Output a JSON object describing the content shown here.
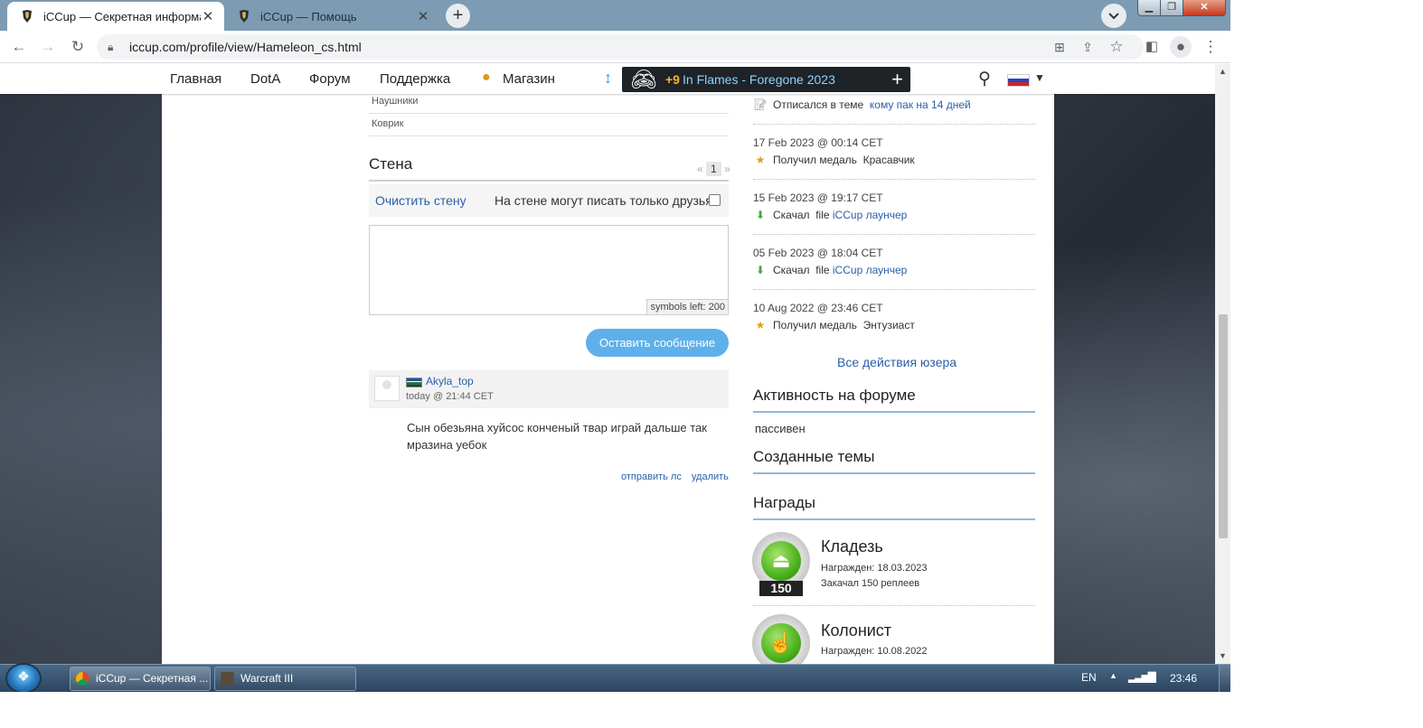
{
  "browser": {
    "tabs": [
      {
        "title": "iCCup — Секретная информаци",
        "active": true
      },
      {
        "title": "iCCup — Помощь",
        "active": false
      }
    ],
    "new_tab": "+",
    "url": "iccup.com/profile/view/Hameleon_cs.html",
    "window_controls": {
      "minimize": "▁",
      "maximize": "❐",
      "close": "✕"
    }
  },
  "site_nav": {
    "items": [
      "Главная",
      "DotA",
      "Форум",
      "Поддержка",
      "Магазин"
    ],
    "promo": {
      "count": "+9",
      "title": "In Flames - Foregone 2023"
    }
  },
  "profile_specs": [
    {
      "label": "Наушники"
    },
    {
      "label": "Коврик"
    }
  ],
  "wall": {
    "title": "Стена",
    "pager": {
      "prev": "«",
      "current": "1",
      "next": "»"
    },
    "clear_label": "Очистить стену",
    "friends_only_label": "На стене могут писать только друзья",
    "symbols_left": "symbols left: 200",
    "post_button": "Оставить сообщение",
    "messages": [
      {
        "author": "Akyla_top",
        "time": "today @ 21:44 CET",
        "text": "Сын обезьяна хуйсос конченый твар играй дальше так мразина уебок",
        "send_pm": "отправить лс",
        "delete": "удалить"
      }
    ]
  },
  "activity": [
    {
      "date": "",
      "icon": "post-icon",
      "action": "Отписался в теме",
      "object_prefix": "",
      "object": "кому пак на 14 дней",
      "object_is_link": true
    },
    {
      "date": "17 Feb 2023 @ 00:14 CET",
      "icon": "medal-icon",
      "action": "Получил медаль",
      "object_prefix": "",
      "object": "Красавчик",
      "object_is_link": false
    },
    {
      "date": "15 Feb 2023 @ 19:17 CET",
      "icon": "download-icon",
      "action": "Скачал",
      "object_prefix": "file",
      "object": "iCCup лаунчер",
      "object_is_link": true
    },
    {
      "date": "05 Feb 2023 @ 18:04 CET",
      "icon": "download-icon",
      "action": "Скачал",
      "object_prefix": "file",
      "object": "iCCup лаунчер",
      "object_is_link": true
    },
    {
      "date": "10 Aug 2022 @ 23:46 CET",
      "icon": "medal-icon",
      "action": "Получил медаль",
      "object_prefix": "",
      "object": "Энтузиаст",
      "object_is_link": false
    }
  ],
  "all_actions_link": "Все действия юзера",
  "forum_activity": {
    "title": "Активность на форуме",
    "value": "пассивен"
  },
  "created_topics": {
    "title": "Созданные темы"
  },
  "awards": {
    "title": "Награды",
    "items": [
      {
        "name": "Кладезь",
        "awarded": "Награжден: 18.03.2023",
        "desc": "Закачал 150 реплеев",
        "count": "150",
        "icon": "upload-icon"
      },
      {
        "name": "Колонист",
        "awarded": "Награжден: 10.08.2022",
        "desc": "",
        "count": "",
        "icon": "hand-cursor-icon"
      }
    ]
  },
  "taskbar": {
    "items": [
      {
        "title": "iCCup — Секретная ...",
        "icon": "chrome-icon"
      },
      {
        "title": "Warcraft III",
        "icon": "warcraft-icon"
      }
    ],
    "lang": "EN",
    "clock": "23:46"
  }
}
